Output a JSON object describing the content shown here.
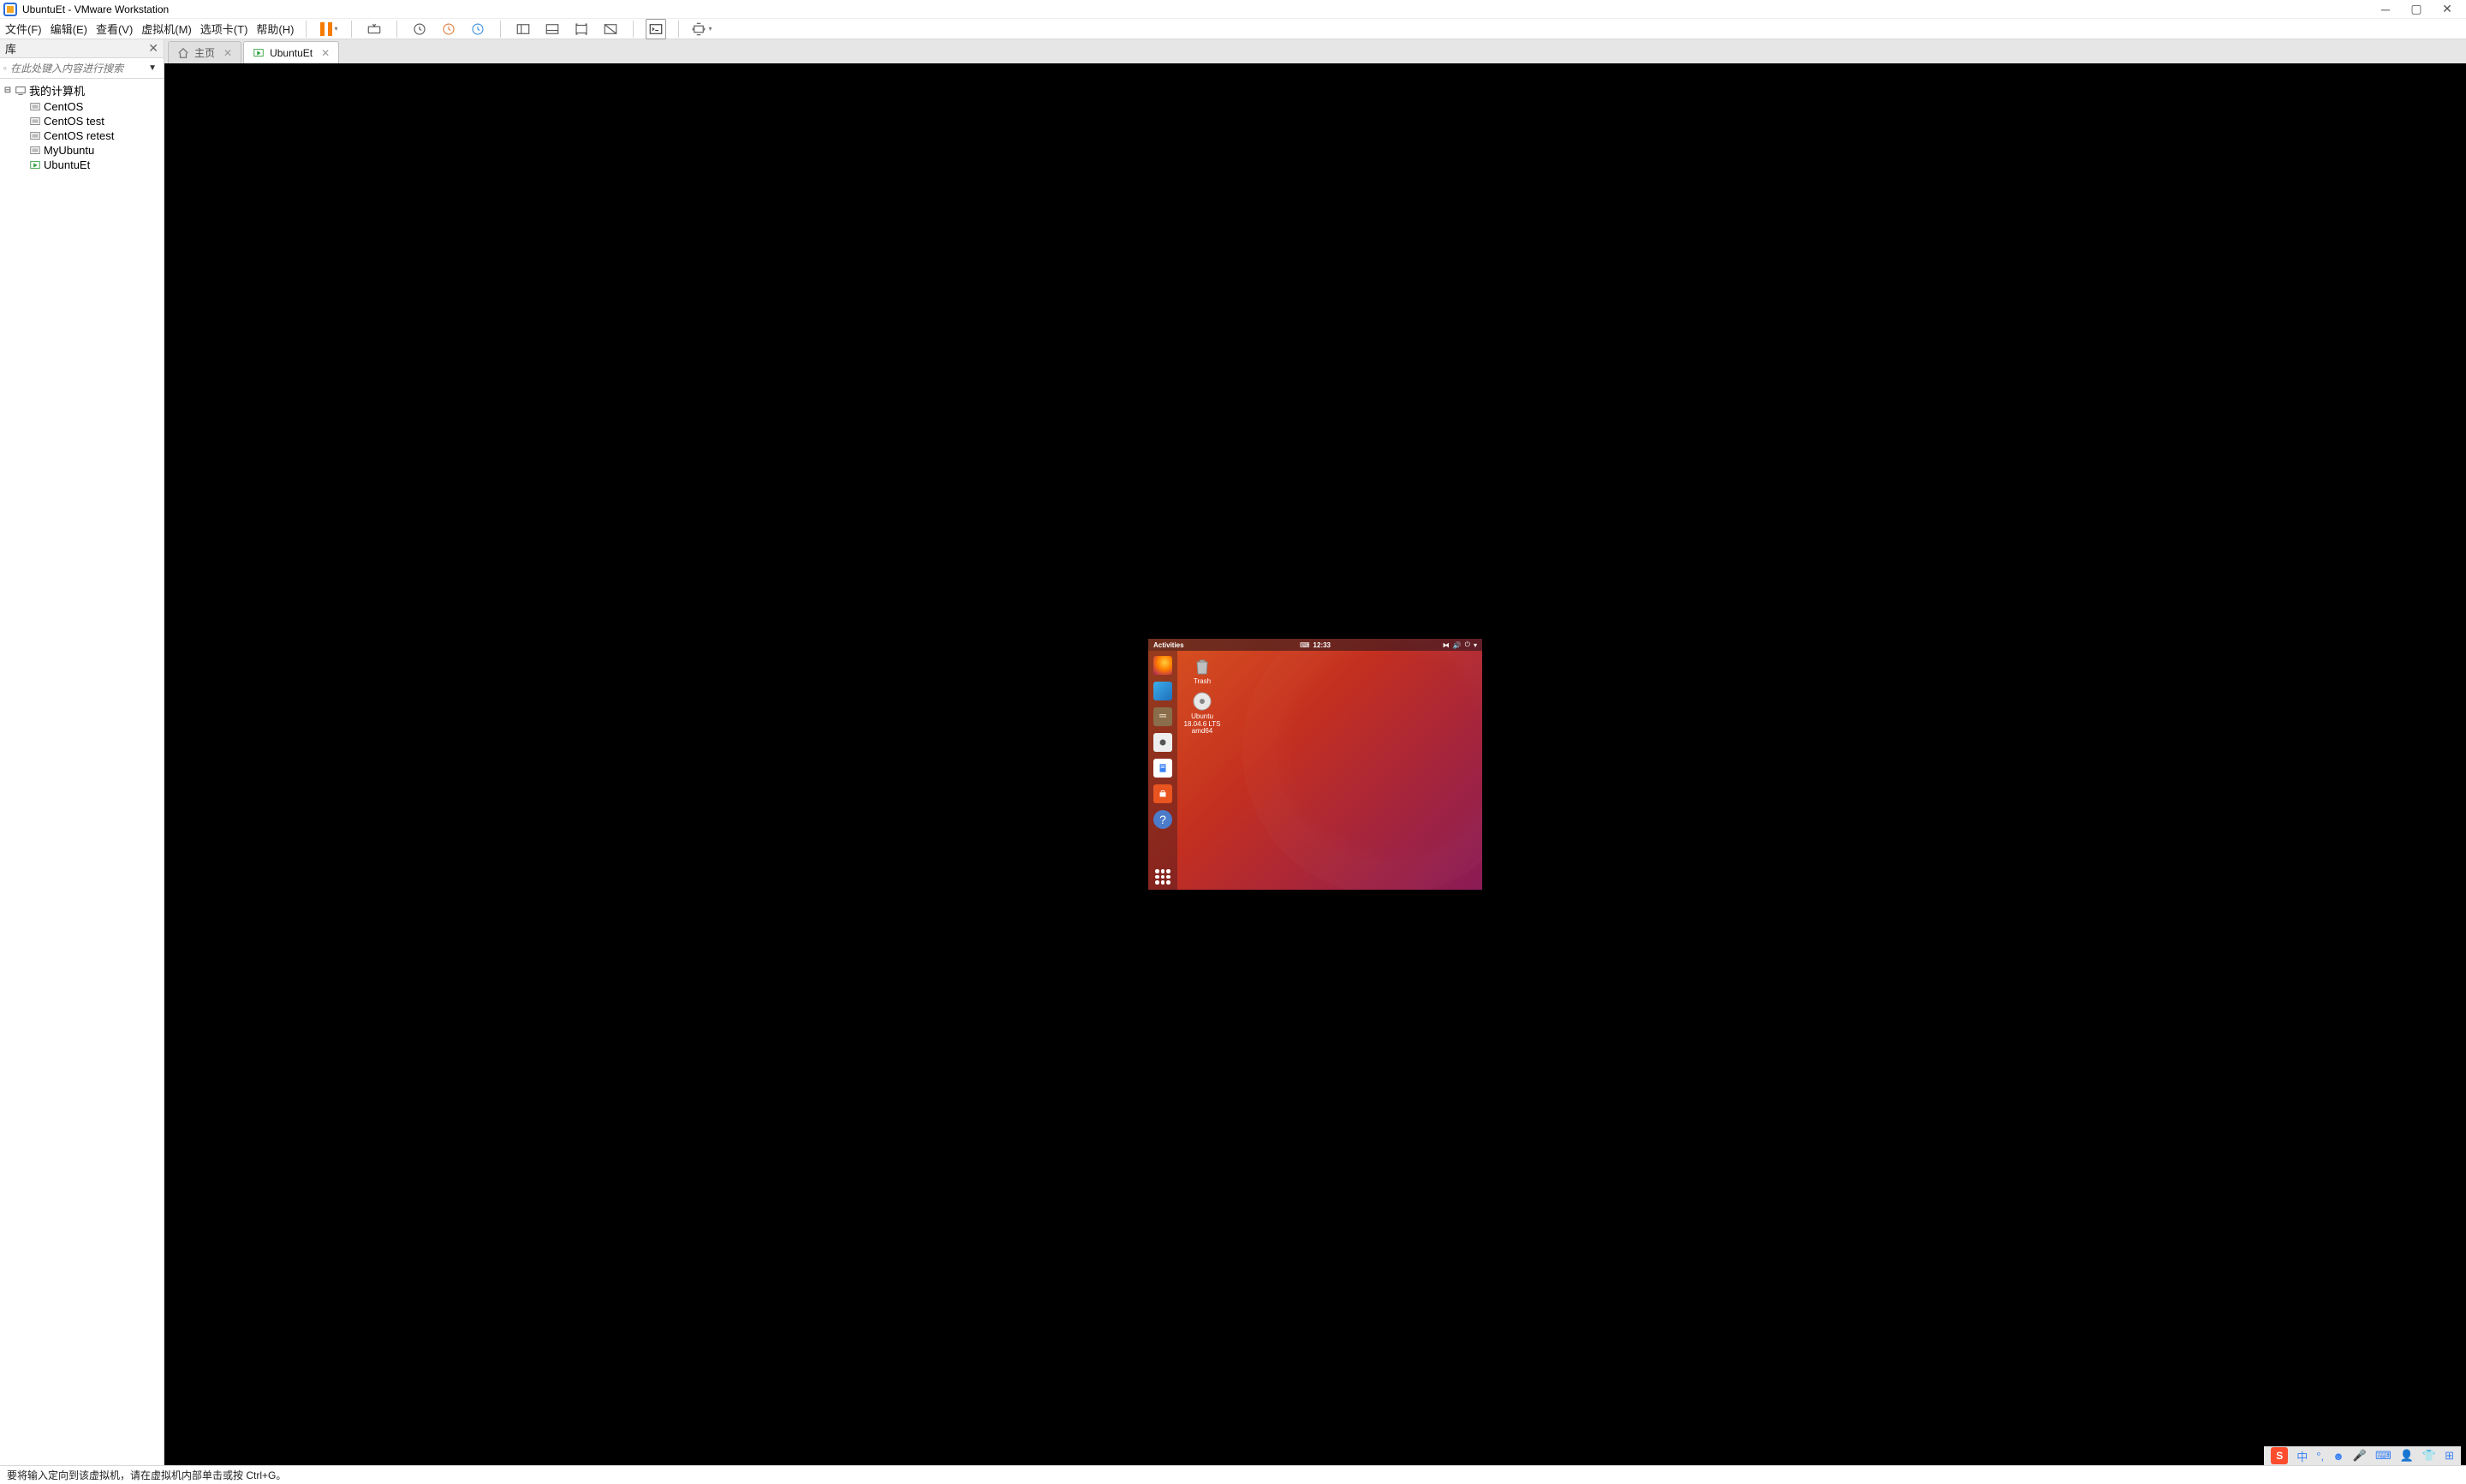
{
  "title": "UbuntuEt - VMware Workstation",
  "menus": {
    "file": "文件(F)",
    "edit": "编辑(E)",
    "view": "查看(V)",
    "vm": "虚拟机(M)",
    "tabs": "选项卡(T)",
    "help": "帮助(H)"
  },
  "sidebar": {
    "header": "库",
    "search_placeholder": "在此处键入内容进行搜索",
    "root": "我的计算机",
    "items": [
      "CentOS",
      "CentOS test",
      "CentOS retest",
      "MyUbuntu",
      "UbuntuEt"
    ]
  },
  "tabs": {
    "home": "主页",
    "vm": "UbuntuEt"
  },
  "ubuntu": {
    "activities": "Activities",
    "time": "12:33",
    "trash": "Trash",
    "disc": "Ubuntu 18.04.6 LTS amd64"
  },
  "status": "要将输入定向到该虚拟机，请在虚拟机内部单击或按 Ctrl+G。",
  "ime": {
    "lang": "中"
  }
}
